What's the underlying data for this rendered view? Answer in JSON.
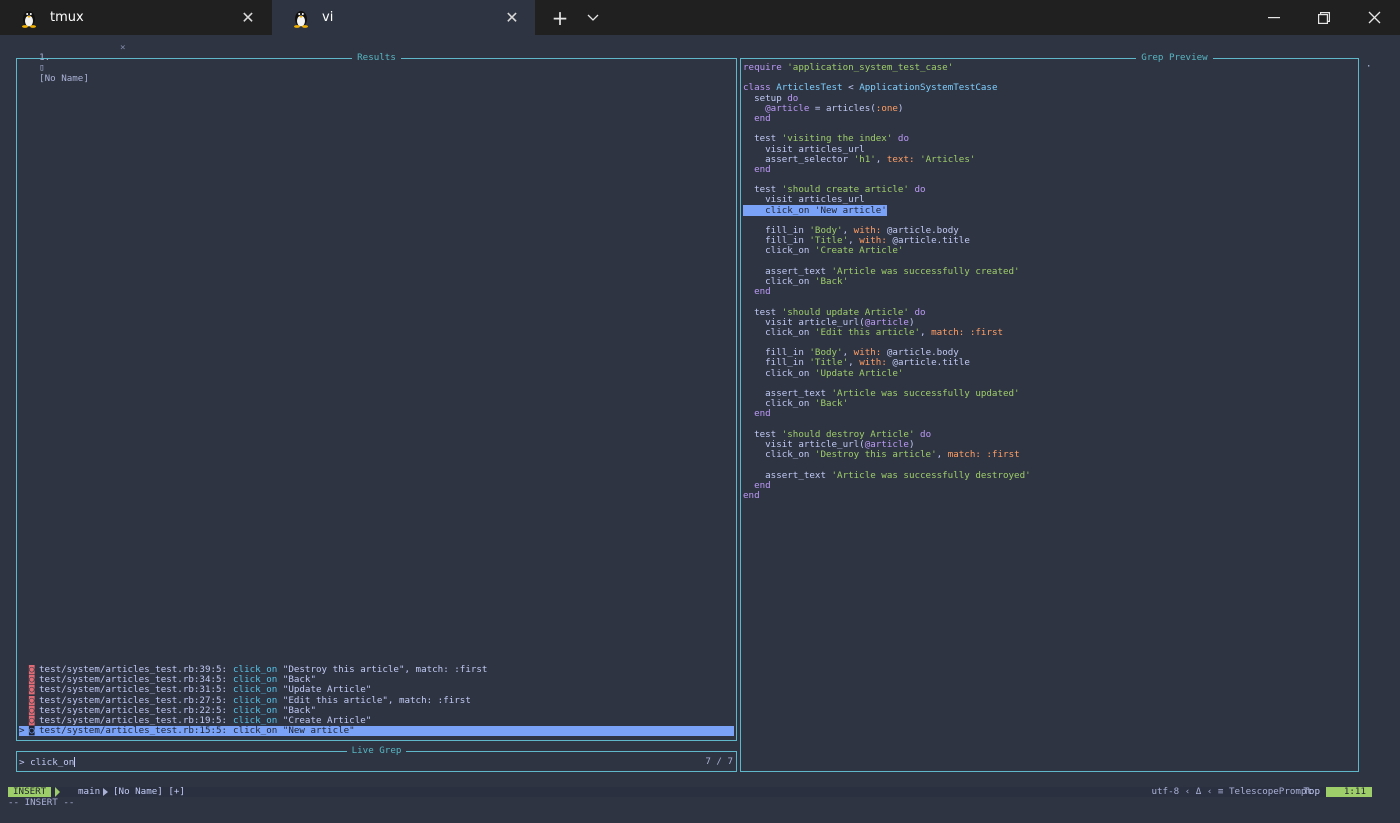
{
  "titlebar": {
    "tabs": [
      {
        "label": "tmux",
        "icon": "tux-icon",
        "active": false
      },
      {
        "label": "vi",
        "icon": "tux-icon",
        "active": true
      }
    ],
    "close_glyph": "✕",
    "new_tab_glyph": "+",
    "dropdown_glyph": "⌄"
  },
  "nvim_tabline": {
    "number": "1.",
    "icon": "▯",
    "name": "[No Name]",
    "close": "×"
  },
  "results_panel": {
    "title": "Results",
    "rows": [
      {
        "caret": " ",
        "icon": "◙",
        "path": "test/system/articles_test.rb:39:5:",
        "fn": "click_on",
        "rest": " \"Destroy this article\", match: :first",
        "selected": false
      },
      {
        "caret": " ",
        "icon": "◙",
        "path": "test/system/articles_test.rb:34:5:",
        "fn": "click_on",
        "rest": " \"Back\"",
        "selected": false
      },
      {
        "caret": " ",
        "icon": "◙",
        "path": "test/system/articles_test.rb:31:5:",
        "fn": "click_on",
        "rest": " \"Update Article\"",
        "selected": false
      },
      {
        "caret": " ",
        "icon": "◙",
        "path": "test/system/articles_test.rb:27:5:",
        "fn": "click_on",
        "rest": " \"Edit this article\", match: :first",
        "selected": false
      },
      {
        "caret": " ",
        "icon": "◙",
        "path": "test/system/articles_test.rb:22:5:",
        "fn": "click_on",
        "rest": " \"Back\"",
        "selected": false
      },
      {
        "caret": " ",
        "icon": "◙",
        "path": "test/system/articles_test.rb:19:5:",
        "fn": "click_on",
        "rest": " \"Create Article\"",
        "selected": false
      },
      {
        "caret": ">",
        "icon": "◙",
        "path": "test/system/articles_test.rb:15:5:",
        "fn": "click_on",
        "rest": " \"New article\"",
        "selected": true
      }
    ]
  },
  "prompt_panel": {
    "title": "Live Grep",
    "prefix": "> ",
    "query": "click_on",
    "counter": "7 / 7"
  },
  "preview_panel": {
    "title": "Grep Preview",
    "lines": [
      [
        {
          "t": "require ",
          "c": "kw"
        },
        {
          "t": "'application_system_test_case'",
          "c": "str"
        }
      ],
      [],
      [
        {
          "t": "class ",
          "c": "kw"
        },
        {
          "t": "ArticlesTest",
          "c": "cls"
        },
        {
          "t": " < ",
          "c": "plain"
        },
        {
          "t": "ApplicationSystemTestCase",
          "c": "cls"
        }
      ],
      [
        {
          "t": "  setup ",
          "c": "plain"
        },
        {
          "t": "do",
          "c": "kw"
        }
      ],
      [
        {
          "t": "    @article",
          "c": "kw"
        },
        {
          "t": " = articles(",
          "c": "plain"
        },
        {
          "t": ":one",
          "c": "sym"
        },
        {
          "t": ")",
          "c": "plain"
        }
      ],
      [
        {
          "t": "  end",
          "c": "kw"
        }
      ],
      [],
      [
        {
          "t": "  test ",
          "c": "plain"
        },
        {
          "t": "'visiting the index'",
          "c": "str"
        },
        {
          "t": " do",
          "c": "kw"
        }
      ],
      [
        {
          "t": "    visit articles_url",
          "c": "plain"
        }
      ],
      [
        {
          "t": "    assert_selector ",
          "c": "plain"
        },
        {
          "t": "'h1'",
          "c": "str"
        },
        {
          "t": ", ",
          "c": "plain"
        },
        {
          "t": "text:",
          "c": "sym"
        },
        {
          "t": " ",
          "c": "plain"
        },
        {
          "t": "'Articles'",
          "c": "str"
        }
      ],
      [
        {
          "t": "  end",
          "c": "kw"
        }
      ],
      [],
      [
        {
          "t": "  test ",
          "c": "plain"
        },
        {
          "t": "'should create article'",
          "c": "str"
        },
        {
          "t": " do",
          "c": "kw"
        }
      ],
      [
        {
          "t": "    visit articles_url",
          "c": "plain"
        }
      ],
      [
        {
          "t": "    click_on 'New article'",
          "c": "hl"
        }
      ],
      [],
      [
        {
          "t": "    fill_in ",
          "c": "plain"
        },
        {
          "t": "'Body'",
          "c": "str"
        },
        {
          "t": ", ",
          "c": "plain"
        },
        {
          "t": "with:",
          "c": "sym"
        },
        {
          "t": " @article.body",
          "c": "plain"
        }
      ],
      [
        {
          "t": "    fill_in ",
          "c": "plain"
        },
        {
          "t": "'Title'",
          "c": "str"
        },
        {
          "t": ", ",
          "c": "plain"
        },
        {
          "t": "with:",
          "c": "sym"
        },
        {
          "t": " @article.title",
          "c": "plain"
        }
      ],
      [
        {
          "t": "    click_on ",
          "c": "plain"
        },
        {
          "t": "'Create Article'",
          "c": "str"
        }
      ],
      [],
      [
        {
          "t": "    assert_text ",
          "c": "plain"
        },
        {
          "t": "'Article was successfully created'",
          "c": "str"
        }
      ],
      [
        {
          "t": "    click_on ",
          "c": "plain"
        },
        {
          "t": "'Back'",
          "c": "str"
        }
      ],
      [
        {
          "t": "  end",
          "c": "kw"
        }
      ],
      [],
      [
        {
          "t": "  test ",
          "c": "plain"
        },
        {
          "t": "'should update Article'",
          "c": "str"
        },
        {
          "t": " do",
          "c": "kw"
        }
      ],
      [
        {
          "t": "    visit article_url(",
          "c": "plain"
        },
        {
          "t": "@article",
          "c": "kw"
        },
        {
          "t": ")",
          "c": "plain"
        }
      ],
      [
        {
          "t": "    click_on ",
          "c": "plain"
        },
        {
          "t": "'Edit this article'",
          "c": "str"
        },
        {
          "t": ", ",
          "c": "plain"
        },
        {
          "t": "match:",
          "c": "sym"
        },
        {
          "t": " :first",
          "c": "sym"
        }
      ],
      [],
      [
        {
          "t": "    fill_in ",
          "c": "plain"
        },
        {
          "t": "'Body'",
          "c": "str"
        },
        {
          "t": ", ",
          "c": "plain"
        },
        {
          "t": "with:",
          "c": "sym"
        },
        {
          "t": " @article.body",
          "c": "plain"
        }
      ],
      [
        {
          "t": "    fill_in ",
          "c": "plain"
        },
        {
          "t": "'Title'",
          "c": "str"
        },
        {
          "t": ", ",
          "c": "plain"
        },
        {
          "t": "with:",
          "c": "sym"
        },
        {
          "t": " @article.title",
          "c": "plain"
        }
      ],
      [
        {
          "t": "    click_on ",
          "c": "plain"
        },
        {
          "t": "'Update Article'",
          "c": "str"
        }
      ],
      [],
      [
        {
          "t": "    assert_text ",
          "c": "plain"
        },
        {
          "t": "'Article was successfully updated'",
          "c": "str"
        }
      ],
      [
        {
          "t": "    click_on ",
          "c": "plain"
        },
        {
          "t": "'Back'",
          "c": "str"
        }
      ],
      [
        {
          "t": "  end",
          "c": "kw"
        }
      ],
      [],
      [
        {
          "t": "  test ",
          "c": "plain"
        },
        {
          "t": "'should destroy Article'",
          "c": "str"
        },
        {
          "t": " do",
          "c": "kw"
        }
      ],
      [
        {
          "t": "    visit article_url(",
          "c": "plain"
        },
        {
          "t": "@article",
          "c": "kw"
        },
        {
          "t": ")",
          "c": "plain"
        }
      ],
      [
        {
          "t": "    click_on ",
          "c": "plain"
        },
        {
          "t": "'Destroy this article'",
          "c": "str"
        },
        {
          "t": ", ",
          "c": "plain"
        },
        {
          "t": "match:",
          "c": "sym"
        },
        {
          "t": " :first",
          "c": "sym"
        }
      ],
      [],
      [
        {
          "t": "    assert_text ",
          "c": "plain"
        },
        {
          "t": "'Article was successfully destroyed'",
          "c": "str"
        }
      ],
      [
        {
          "t": "  end",
          "c": "kw"
        }
      ],
      [
        {
          "t": "end",
          "c": "kw"
        }
      ]
    ]
  },
  "statusline": {
    "mode": "INSERT",
    "branch_icon": "",
    "branch": "main",
    "file": "[No Name] [+]",
    "encoding": "utf-8",
    "fileformat_icon": "Δ",
    "filetype_icon": "≡",
    "filetype": "TelescopePrompt",
    "scroll": "Top",
    "position": "1:11"
  },
  "cmdline": "-- INSERT --",
  "colors": {
    "accent": "#7aa2f7",
    "border": "#5fb7c9",
    "mode_green": "#9ece6a",
    "background": "#2f3442"
  }
}
